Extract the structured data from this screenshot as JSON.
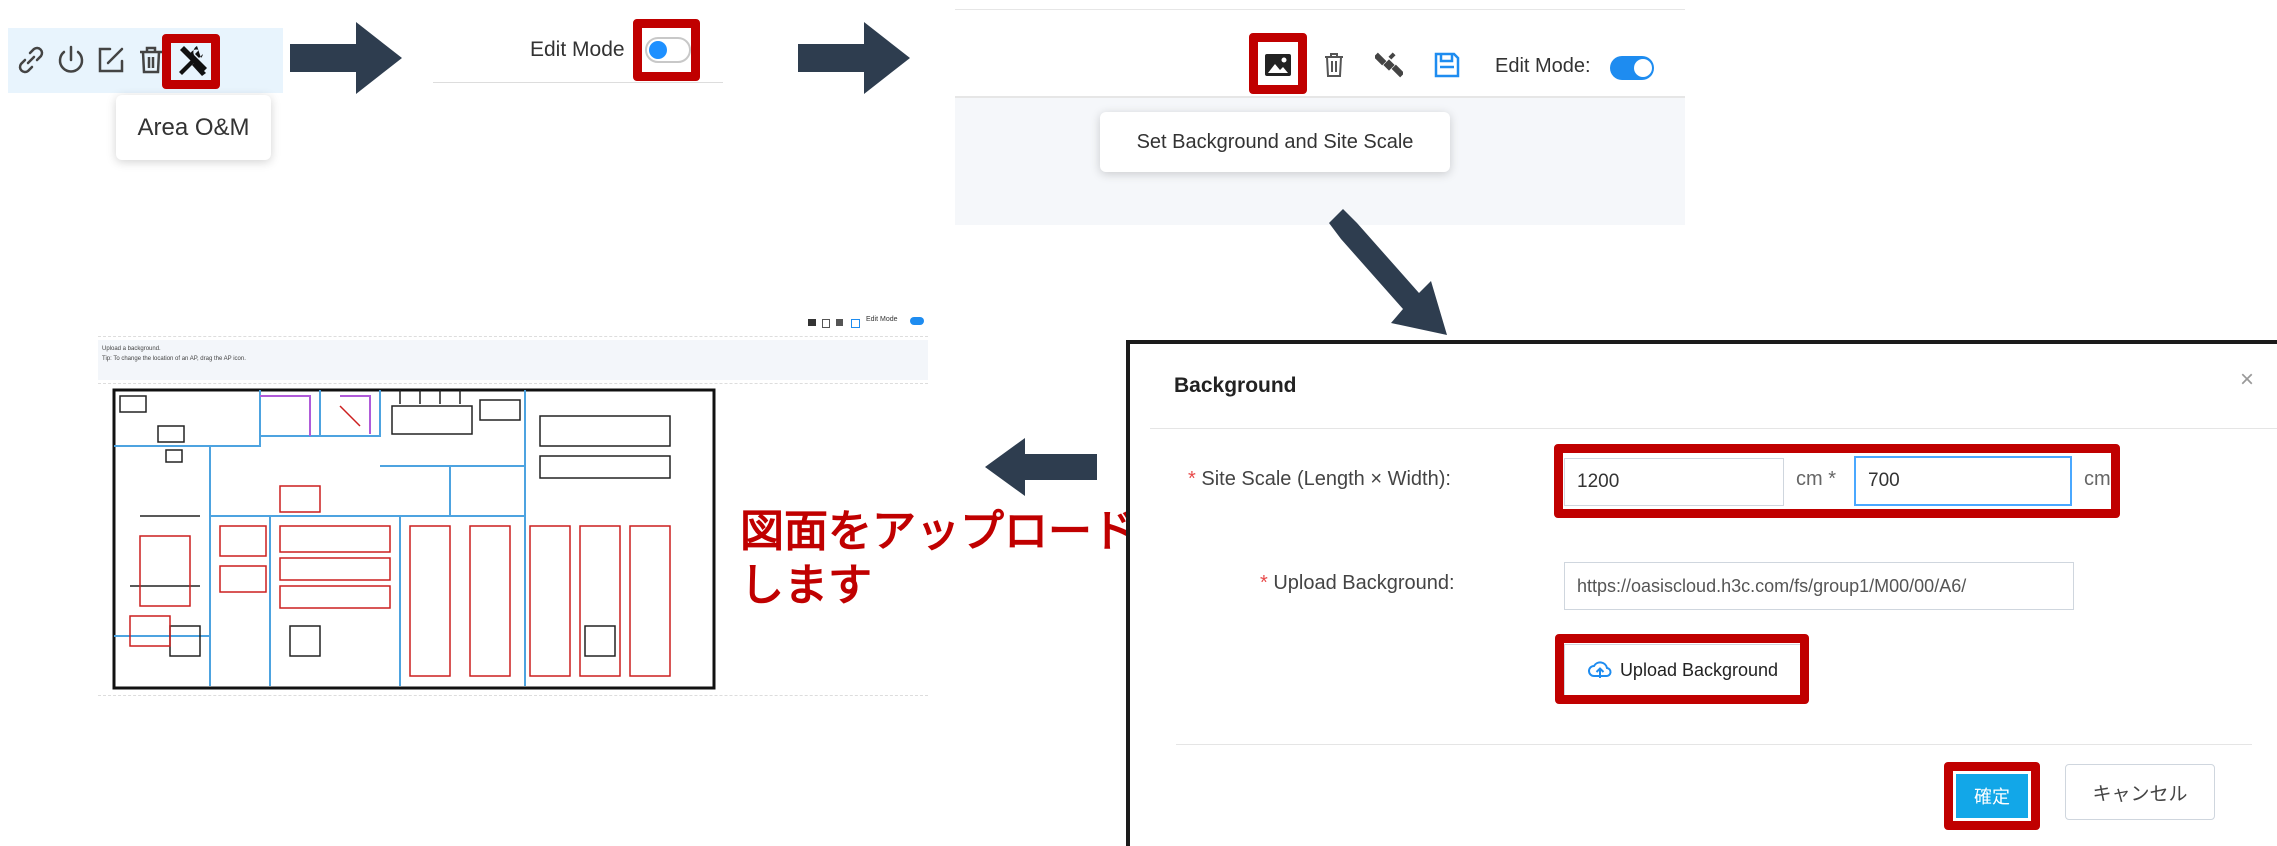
{
  "panel1": {
    "tooltip": "Area O&M",
    "icons": [
      "link-icon",
      "power-icon",
      "edit-icon",
      "trash-icon",
      "tools-icon"
    ]
  },
  "panel2": {
    "edit_mode_label": "Edit Mode",
    "toggle_state": "off"
  },
  "panel3": {
    "edit_mode_label": "Edit Mode:",
    "toggle_state": "on",
    "tooltip": "Set Background and Site Scale",
    "icons": [
      "image-icon",
      "trash-icon",
      "satellite-icon",
      "save-icon"
    ]
  },
  "floorplan": {
    "toolbar_label": "Edit Mode",
    "hint_line1": "Upload a background.",
    "hint_line2": "Tip: To change the location of an AP, drag the AP icon."
  },
  "annotation": {
    "line1": "図面をアップロード",
    "line2": "します"
  },
  "dialog": {
    "title": "Background",
    "close": "×",
    "site_scale_label": "Site Scale (Length × Width):",
    "length_value": "1200",
    "unit1": "cm *",
    "width_value": "700",
    "unit2": "cm",
    "upload_label": "Upload Background:",
    "url_value": "https://oasiscloud.h3c.com/fs/group1/M00/00/A6/",
    "upload_button": "Upload Background",
    "ok_button": "確定",
    "cancel_button": "キャンセル",
    "required_mark": "*"
  },
  "colors": {
    "highlight": "#c00000",
    "arrow": "#2e3d4f",
    "accent_blue": "#1e90ff",
    "ok_button": "#12a7e8"
  }
}
